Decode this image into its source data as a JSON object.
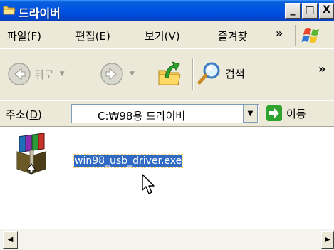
{
  "window": {
    "title": "드라이버",
    "minimize": "_",
    "maximize": "□",
    "close": "X"
  },
  "menu": {
    "items": [
      {
        "label": "파일(",
        "accel": "F",
        "tail": ")"
      },
      {
        "label": "편집(",
        "accel": "E",
        "tail": ")"
      },
      {
        "label": "보기(",
        "accel": "V",
        "tail": ")"
      },
      {
        "label": "즐겨찾",
        "accel": "",
        "tail": ""
      }
    ],
    "overflow": "»"
  },
  "toolbar": {
    "back_label": "뒤로",
    "search_label": "검색",
    "overflow": "»"
  },
  "address": {
    "label": "주소(",
    "accel": "D",
    "tail": ")",
    "value": "C:₩98용 드라이버",
    "go_label": "이동"
  },
  "content": {
    "files": [
      {
        "name": "win98_usb_driver.exe",
        "icon": "winrar-archive-icon",
        "selected": true
      }
    ]
  },
  "colors": {
    "titlebar": "#0054e3",
    "chrome": "#ece9d8",
    "selection": "#316ac5"
  }
}
